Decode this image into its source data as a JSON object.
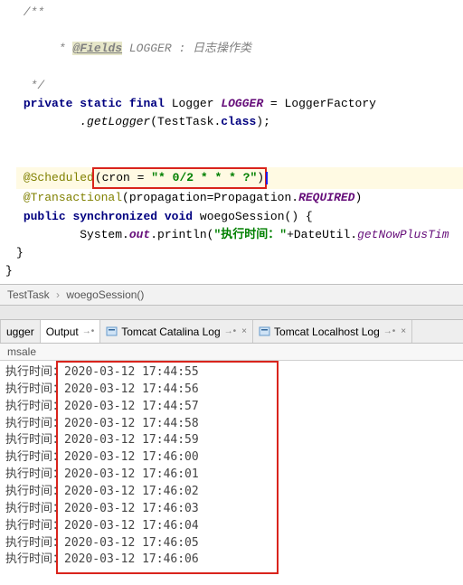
{
  "code": {
    "javadoc_open": " /**",
    "javadoc_field_tag": "@Fields",
    "javadoc_field_rest": " LOGGER : 日志操作类",
    "javadoc_close": "  */",
    "decl_private": "private",
    "decl_static": "static",
    "decl_final": "final",
    "decl_type": "Logger",
    "decl_name": "LOGGER",
    "decl_eq": " = LoggerFactory",
    "getlogger": ".getLogger",
    "getlogger_arg_open": "(TestTask.",
    "class_kw": "class",
    "getlogger_arg_close": ");",
    "sched_anno": "@Scheduled",
    "sched_open": "(cron = ",
    "sched_cron": "\"* 0/2 * * * ?\"",
    "sched_close": ")",
    "tx_anno": "@Transactional",
    "tx_args_open": "(propagation=Propagation.",
    "tx_required": "REQUIRED",
    "tx_args_close": ")",
    "m_public": "public",
    "m_sync": "synchronized",
    "m_void": "void",
    "m_name": "woegoSession",
    "m_paren": "() {",
    "sysout_sys": "System.",
    "sysout_out": "out",
    "sysout_println": ".println(",
    "sysout_str": "\"执行时间：\"",
    "sysout_rest": "+DateUtil.",
    "sysout_call": "getNowPlusTim",
    "brace_close": "}",
    "brace_close2": "}"
  },
  "breadcrumb": {
    "a": "TestTask",
    "b": "woegoSession()"
  },
  "tabs": {
    "t0": "ugger",
    "t1": "Output",
    "t2": "Tomcat Catalina Log",
    "t3": "Tomcat Localhost Log",
    "msale": "msale"
  },
  "console": {
    "lines": [
      "执行时间：2020-03-12 17:44:55",
      "执行时间：2020-03-12 17:44:56",
      "执行时间：2020-03-12 17:44:57",
      "执行时间：2020-03-12 17:44:58",
      "执行时间：2020-03-12 17:44:59",
      "执行时间：2020-03-12 17:46:00",
      "执行时间：2020-03-12 17:46:01",
      "执行时间：2020-03-12 17:46:02",
      "执行时间：2020-03-12 17:46:03",
      "执行时间：2020-03-12 17:46:04",
      "执行时间：2020-03-12 17:46:05",
      "执行时间：2020-03-12 17:46:06"
    ]
  }
}
